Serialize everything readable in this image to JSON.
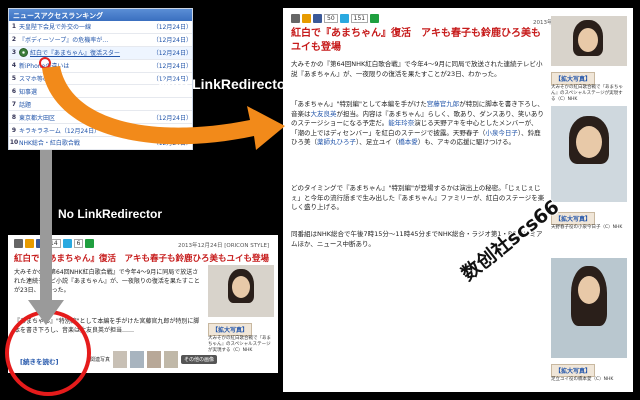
{
  "ranking": {
    "header": "ニュースアクセスランキング",
    "items": [
      {
        "num": "1",
        "title": "天皇陛下会見で外交の一線",
        "date": "（12月24日）"
      },
      {
        "num": "2",
        "title": "『ボディーソープ』の危機率が…",
        "date": "（12月24日）"
      },
      {
        "num": "3",
        "title": "紅白で『あまちゃん』復活スター",
        "date": "（12月24日）",
        "highlight": true
      },
      {
        "num": "4",
        "title": "新iPhoneの違いは",
        "date": "（12月24日）"
      },
      {
        "num": "5",
        "title": "スマホ等の料金",
        "date": "（12月24日）"
      },
      {
        "num": "6",
        "title": "知事選",
        "date": ""
      },
      {
        "num": "7",
        "title": "話題",
        "date": ""
      },
      {
        "num": "8",
        "title": "東京都大田区",
        "date": "（12月24日）"
      },
      {
        "num": "9",
        "title": "キラキラネーム（12月24日）",
        "date": ""
      },
      {
        "num": "10",
        "title": "NHK総合・紅白歌合戦",
        "date": "（12月24日）"
      }
    ]
  },
  "labels": {
    "with": "With LinkRedirector",
    "without": "No LinkRedirector"
  },
  "main_article": {
    "share_counts": {
      "fb": "50",
      "tw": "151"
    },
    "date": "2013年12月24日 [ORICON STYLE]",
    "headline": "紅白で『あまちゃん』復活　アキも春子も鈴鹿ひろ美もユイも登場",
    "para1": "大みそかの『第64回NHK紅白歌合戦』で今年4〜9月に同局で放送された連続テレビ小説『あまちゃん』が、一夜限りの復活を果たすことが23日、わかった。",
    "para2a": "「あまちゃん」\"特別編\"として本編を手がけた",
    "para2_link1": "宮藤官九郎",
    "para2b": "が特別に脚本を書き下ろし、音楽は",
    "para2_link2": "大友良英",
    "para2c": "が担当。内容は『あまちゃん』らしく、歌あり、ダンスあり、笑いありのステージショーになる予定だ。",
    "para2_link3": "能年玲奈",
    "para2d": "演じる天野アキを中心としたメンバーが、「潮の上ではディセンバー」を紅白のステージで披露。天野春子（",
    "para2_link4": "小泉今日子",
    "para2e": "）、鈴鹿ひろ美（",
    "para2_link5": "薬師丸ひろ子",
    "para2f": "）、足立ユイ（",
    "para2_link6": "橋本愛",
    "para2g": "）も、アキの応援に駆けつける。",
    "para3": "どのタイミングで『あまちゃん』\"特別編\"が登場するかは演出上の秘密。「じぇじぇじぇ」と今年の流行語まで生み出した『あまちゃん』ファミリーが、紅白のステージを楽しく盛り上げる。",
    "para4": "同番組はNHK総合で午後7時15分〜11時45分までNHK総合・ラジオ第1・BSプレミアムほか、ニュース中断あり。",
    "photos": [
      {
        "enlarge": "【拡大写真】",
        "caption": "大みそかの紅白歌合戦で『あまちゃん』のスペシャルステージが実現する（C）NHK"
      },
      {
        "enlarge": "【拡大写真】",
        "caption": "天野春子役の小泉今日子（C）NHK"
      },
      {
        "enlarge": "【拡大写真】",
        "caption": "天野春子役の小泉今日子（C）NHK"
      },
      {
        "enlarge": "【拡大写真】",
        "caption": "足立ユイ役の橋本愛（C）NHK"
      }
    ]
  },
  "bottom_article": {
    "share_counts": {
      "fb": "14",
      "tw": "6"
    },
    "date": "2013年12月24日 [ORICON STYLE]",
    "headline": "紅白で『あまちゃん』復活　アキも春子も鈴鹿ひろ美もユイも登場",
    "para1": "大みそかの『第64回NHK紅白歌合戦』で今年4〜9月に同局で放送された連続テレビ小説『あまちゃん』が、一夜限りの復活を果たすことが23日、わかった。",
    "para2": "『あまちゃん』\"特別編\"として本編を手がけた宮藤官九郎が特別に脚本を書き下ろし、音楽は大友良英が担当……",
    "photo_enlarge": "【拡大写真】",
    "photo_caption": "大みそかの紅白歌合戦で『あまちゃん』のスペシャルステージが実現する（C）NHK",
    "readmore": "[続きを読む]",
    "related_label": "関連写真",
    "more_button": "その他の画像"
  },
  "watermark": "数创社scs66",
  "colors": {
    "arrow_orange": "#f28a1a",
    "arrow_gray": "#9a9a9a",
    "headline_red": "#c61a1a",
    "link_blue": "#2255aa",
    "circle_red": "#e51b1b"
  }
}
